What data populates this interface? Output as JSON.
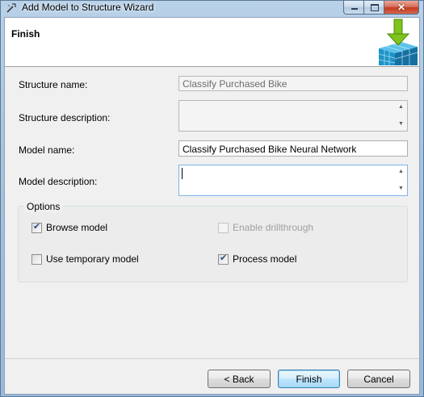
{
  "window": {
    "title": "Add Model to Structure Wizard",
    "caption_buttons": {
      "minimize": "minimize",
      "maximize": "maximize",
      "close": "✕"
    }
  },
  "header": {
    "title": "Finish"
  },
  "form": {
    "structure_name": {
      "label": "Structure name:",
      "value": "Classify Purchased Bike",
      "enabled": false
    },
    "structure_description": {
      "label": "Structure description:",
      "value": "",
      "enabled": false
    },
    "model_name": {
      "label": "Model name:",
      "value": "Classify Purchased Bike Neural Network",
      "enabled": true
    },
    "model_description": {
      "label": "Model description:",
      "value": "",
      "enabled": true
    }
  },
  "options": {
    "title": "Options",
    "browse_model": {
      "label": "Browse model",
      "checked": true,
      "enabled": true
    },
    "enable_drillthrough": {
      "label": "Enable drillthrough",
      "checked": false,
      "enabled": false
    },
    "use_temporary_model": {
      "label": "Use temporary model",
      "checked": false,
      "enabled": true
    },
    "process_model": {
      "label": "Process model",
      "checked": true,
      "enabled": true
    }
  },
  "buttons": {
    "back": "< Back",
    "finish": "Finish",
    "cancel": "Cancel"
  },
  "colors": {
    "title_bar": "#a6c3e0",
    "close_button": "#c4391f",
    "header_graphic_arrow": "#7fc31c",
    "header_graphic_cube": "#1d94c7"
  }
}
